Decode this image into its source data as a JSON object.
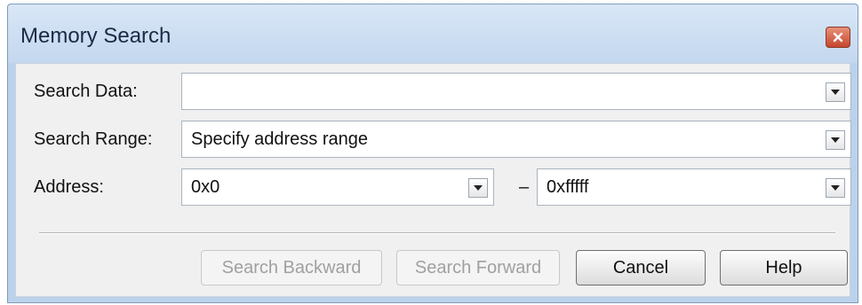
{
  "window": {
    "title": "Memory Search",
    "close_icon": "close-icon"
  },
  "search_data": {
    "label": "Search Data:",
    "value": ""
  },
  "search_range": {
    "label": "Search Range:",
    "value": "Specify address range"
  },
  "address": {
    "label": "Address:",
    "start_value": "0x0",
    "separator": "–",
    "end_value": "0xfffff"
  },
  "buttons": {
    "search_backward": "Search Backward",
    "search_forward": "Search Forward",
    "cancel": "Cancel",
    "help": "Help"
  },
  "colors": {
    "titlebar": "#c9dcf1",
    "close_button": "#d05a40",
    "client_bg": "#f0f0f0"
  }
}
